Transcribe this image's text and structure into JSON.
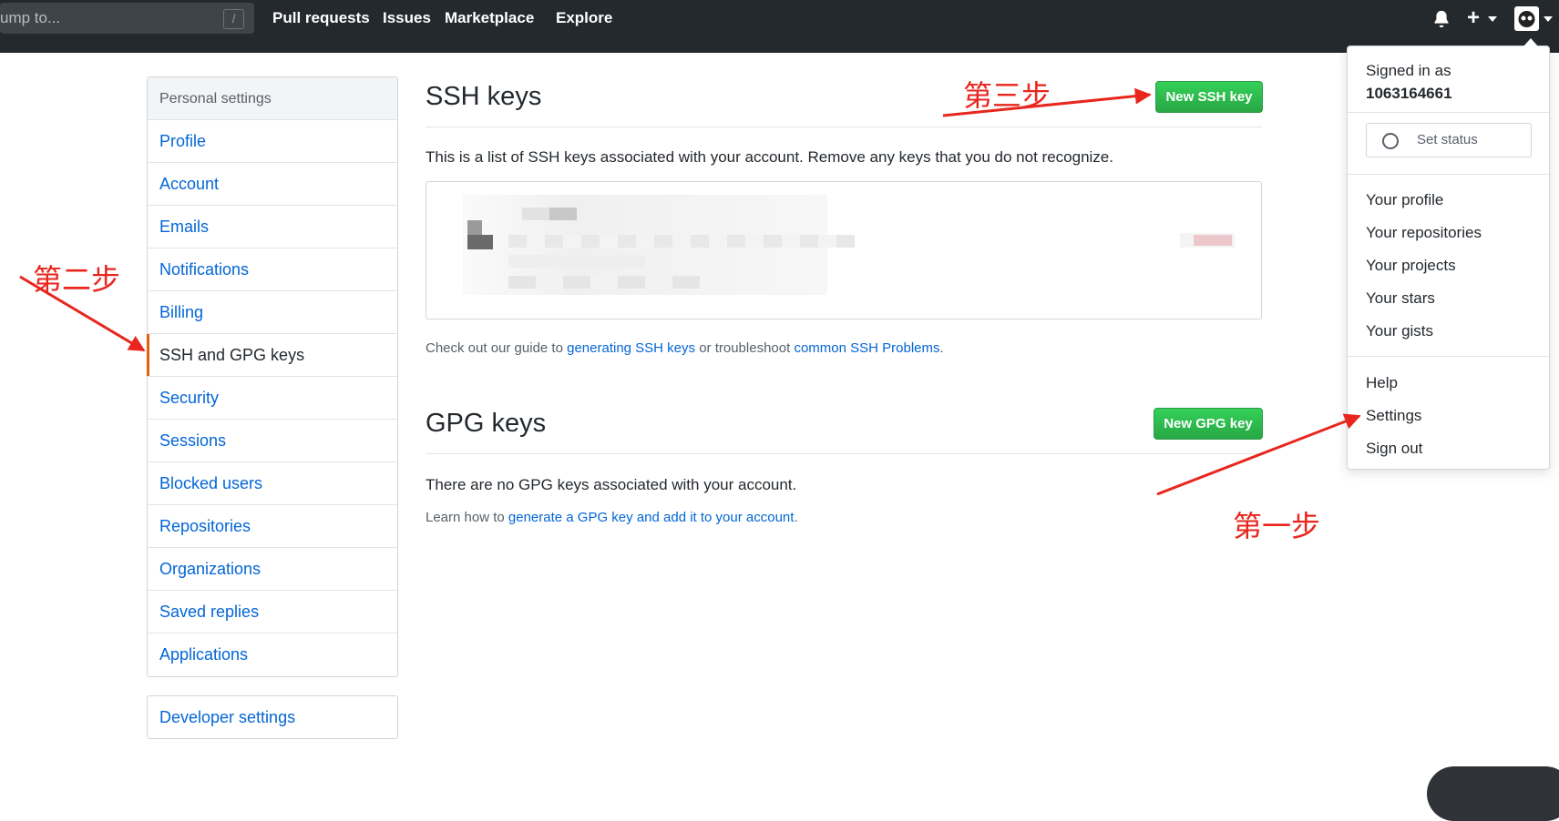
{
  "topbar": {
    "search_placeholder": "ump to...",
    "slash_key": "/",
    "nav": [
      "Pull requests",
      "Issues",
      "Marketplace",
      "Explore"
    ]
  },
  "sidebar": {
    "header": "Personal settings",
    "items": [
      {
        "label": "Profile",
        "selected": false
      },
      {
        "label": "Account",
        "selected": false
      },
      {
        "label": "Emails",
        "selected": false
      },
      {
        "label": "Notifications",
        "selected": false
      },
      {
        "label": "Billing",
        "selected": false
      },
      {
        "label": "SSH and GPG keys",
        "selected": true
      },
      {
        "label": "Security",
        "selected": false
      },
      {
        "label": "Sessions",
        "selected": false
      },
      {
        "label": "Blocked users",
        "selected": false
      },
      {
        "label": "Repositories",
        "selected": false
      },
      {
        "label": "Organizations",
        "selected": false
      },
      {
        "label": "Saved replies",
        "selected": false
      },
      {
        "label": "Applications",
        "selected": false
      }
    ],
    "developer_settings": "Developer settings"
  },
  "ssh": {
    "title": "SSH keys",
    "new_button": "New SSH key",
    "description": "This is a list of SSH keys associated with your account. Remove any keys that you do not recognize.",
    "guide_prefix": "Check out our guide to ",
    "guide_link": "generating SSH keys",
    "guide_middle": " or troubleshoot ",
    "guide_link2": "common SSH Problems",
    "guide_suffix": "."
  },
  "gpg": {
    "title": "GPG keys",
    "new_button": "New GPG key",
    "empty": "There are no GPG keys associated with your account.",
    "learn_prefix": "Learn how to ",
    "learn_link": "generate a GPG key and add it to your account",
    "learn_suffix": "."
  },
  "dropdown": {
    "signed_in_as": "Signed in as",
    "username": "1063164661",
    "set_status": "Set status",
    "group1": [
      "Your profile",
      "Your repositories",
      "Your projects",
      "Your stars",
      "Your gists"
    ],
    "group2": [
      "Help",
      "Settings",
      "Sign out"
    ]
  },
  "annotations": {
    "step1": "第一步",
    "step2": "第二步",
    "step3": "第三步"
  },
  "icons": {
    "bell": "bell-icon",
    "plus": "plus-icon",
    "avatar": "avatar",
    "smiley": "smiley-icon"
  },
  "colors": {
    "topbar": "#24292e",
    "link": "#0366d6",
    "button_green": "#28a745",
    "selected_marker": "#e36209",
    "annotation_red": "#e8261e"
  }
}
